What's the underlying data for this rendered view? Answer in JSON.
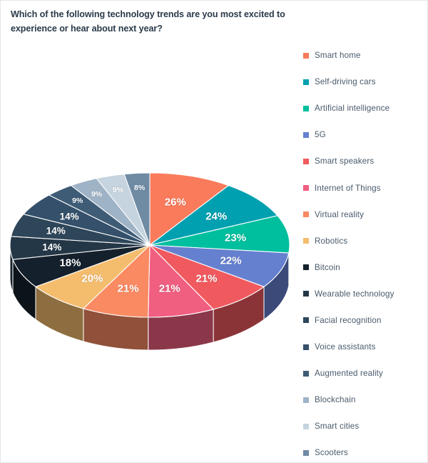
{
  "title": "Which of the following technology trends are you most excited to experience or hear about next year?",
  "legend": {
    "items": [
      {
        "label": "Smart home",
        "color": "#f97b5c"
      },
      {
        "label": "Self-driving cars",
        "color": "#00a0b0"
      },
      {
        "label": "Artificial intelligence",
        "color": "#00bf9e"
      },
      {
        "label": "5G",
        "color": "#6680d0"
      },
      {
        "label": "Smart speakers",
        "color": "#f05a5f"
      },
      {
        "label": "Internet of Things",
        "color": "#f05e80"
      },
      {
        "label": "Virtual reality",
        "color": "#f98a62"
      },
      {
        "label": "Robotics",
        "color": "#f4bd6e"
      },
      {
        "label": "Bitcoin",
        "color": "#14202b"
      },
      {
        "label": "Wearable technology",
        "color": "#243747"
      },
      {
        "label": "Facial recognition",
        "color": "#2e4659"
      },
      {
        "label": "Voice assistants",
        "color": "#34506a"
      },
      {
        "label": "Augmented reality",
        "color": "#3e5c76"
      },
      {
        "label": "Blockchain",
        "color": "#9fb3c6"
      },
      {
        "label": "Smart cities",
        "color": "#c5d4de"
      },
      {
        "label": "Scooters",
        "color": "#6f8ba4"
      }
    ]
  },
  "chart_data": {
    "type": "pie",
    "title": "Which of the following technology trends are you most excited to experience or hear about next year?",
    "style": "3d-pie",
    "legend_position": "right",
    "unit": "%",
    "categories": [
      "Smart home",
      "Self-driving cars",
      "Artificial intelligence",
      "5G",
      "Smart speakers",
      "Internet of Things",
      "Virtual reality",
      "Robotics",
      "Bitcoin",
      "Wearable technology",
      "Facial recognition",
      "Voice assistants",
      "Augmented reality",
      "Blockchain",
      "Smart cities",
      "Scooters"
    ],
    "values": [
      26,
      24,
      23,
      22,
      21,
      21,
      21,
      20,
      18,
      14,
      14,
      14,
      9,
      9,
      9,
      8
    ],
    "data_labels": [
      "26%",
      "24%",
      "23%",
      "22%",
      "21%",
      "21%",
      "21%",
      "20%",
      "18%",
      "14%",
      "14%",
      "14%",
      "9%",
      "9%",
      "9%",
      "8%"
    ],
    "colors": [
      "#f97b5c",
      "#00a0b0",
      "#00bf9e",
      "#6680d0",
      "#f05a5f",
      "#f05e80",
      "#f98a62",
      "#f4bd6e",
      "#14202b",
      "#243747",
      "#2e4659",
      "#34506a",
      "#3e5c76",
      "#9fb3c6",
      "#c5d4de",
      "#6f8ba4"
    ]
  }
}
